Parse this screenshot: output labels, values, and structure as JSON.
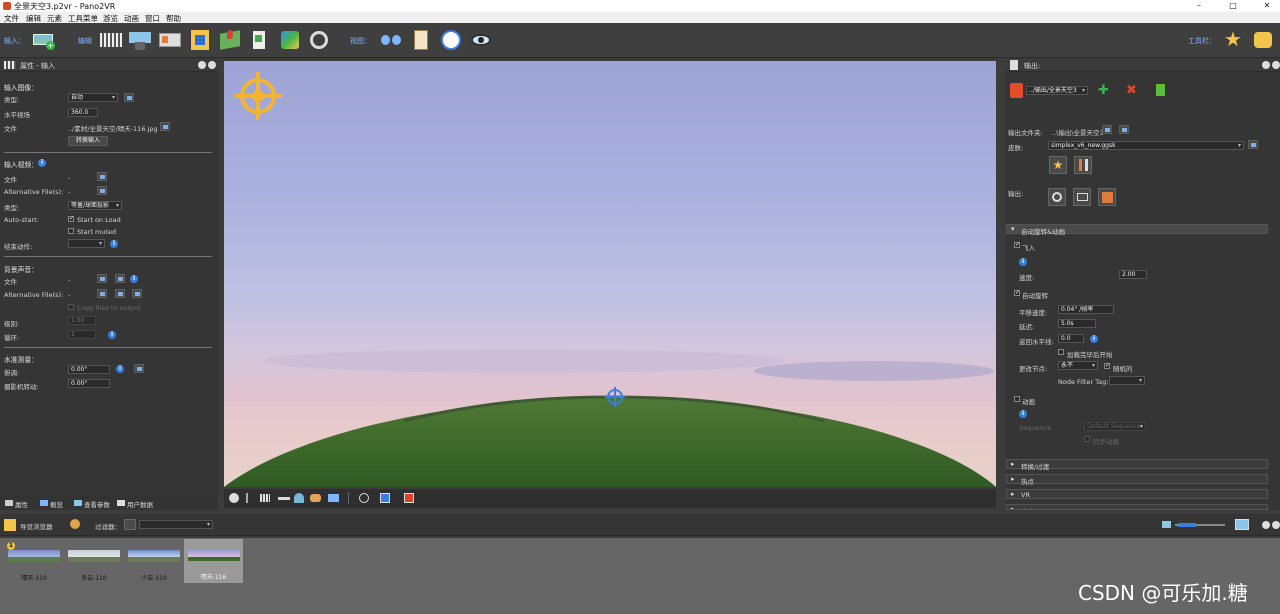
{
  "window": {
    "title": "全景天空3.p2vr - Pano2VR"
  },
  "menu": [
    "文件",
    "编辑",
    "元素",
    "工具菜单",
    "游览",
    "动画",
    "窗口",
    "帮助"
  ],
  "toolbar": {
    "input_label": "输入：",
    "edit_label": "编辑",
    "view_label": "视图：",
    "tools_label": "工具栏："
  },
  "left": {
    "header": "属性 - 输入",
    "input_image": "输入图像：",
    "type_label": "类型:",
    "type_value": "自动",
    "hfov_label": "水平视场",
    "hfov_value": "360.0",
    "file_label": "文件",
    "file_value": "../素材/全景天空/晴天-116.jpg",
    "convert_button": "转换输入",
    "input_video": "输入视频：",
    "video_file_label": "文件",
    "video_file_value": "-",
    "alt_files_label": "Alternative File(s):",
    "alt_files_value": "-",
    "video_type_label": "类型:",
    "video_type_value": "等量/球面投影",
    "autostart_label": "Auto-start:",
    "start_on_load": "Start on Load",
    "start_muted": "Start muted",
    "end_action_label": "结束动作:",
    "bg_sound": "背景声音：",
    "sound_file_label": "文件",
    "sound_file_value": "-",
    "sound_alt_label": "Alternative File(s):",
    "sound_alt_value": "-",
    "copy_files": "Copy files to output",
    "level_label": "级别:",
    "level_value": "1.00",
    "loop_label": "循环:",
    "loop_value": "1",
    "level_correction": "水准测量：",
    "pitch_label": "俯调:",
    "pitch_value": "0.00°",
    "roll_label": "摄影机转动:",
    "roll_value": "0.00°"
  },
  "left_tabs": [
    "属性",
    "概览",
    "查看参数",
    "用户数据"
  ],
  "right": {
    "header": "输出:",
    "format_value": "../输出/全景天空3",
    "output_folder_label": "输出文件夹:",
    "output_folder_value": "..\\输出\\全景天空3",
    "skin_label": "皮肤:",
    "skin_value": "simplex_v6_new.ggsk",
    "output_label": "输出:",
    "autorotate_section": "自动旋转&动画",
    "fly_in": "飞入",
    "speed_label": "速度:",
    "speed_value": "2.00",
    "autorotate": "自动旋转",
    "pan_speed_label": "平移速度:",
    "pan_speed_value": "0.04° /帧率",
    "delay_label": "延迟:",
    "delay_value": "5.0s",
    "return_label": "返回水平线:",
    "return_value": "0.0",
    "start_after_load": "加载完毕后开始",
    "change_node_label": "更改节点:",
    "change_node_value": "永不",
    "random": "随机的",
    "node_filter_label": "Node Filter Tag:",
    "animation": "动画",
    "sequence_label": "Sequence",
    "sequence_value": "Default Sequence",
    "loop_all": "同步动画",
    "sections": [
      "转换/过渡",
      "热点",
      "VR",
      "声音"
    ]
  },
  "bottom": {
    "tour_browser": "导览浏览器",
    "filter_label": "过滤器："
  },
  "thumbs": [
    {
      "label": "晴天-110"
    },
    {
      "label": "多云-110"
    },
    {
      "label": "少云-110"
    },
    {
      "label": "晴天-116"
    }
  ],
  "watermark": "CSDN @可乐加.糖"
}
